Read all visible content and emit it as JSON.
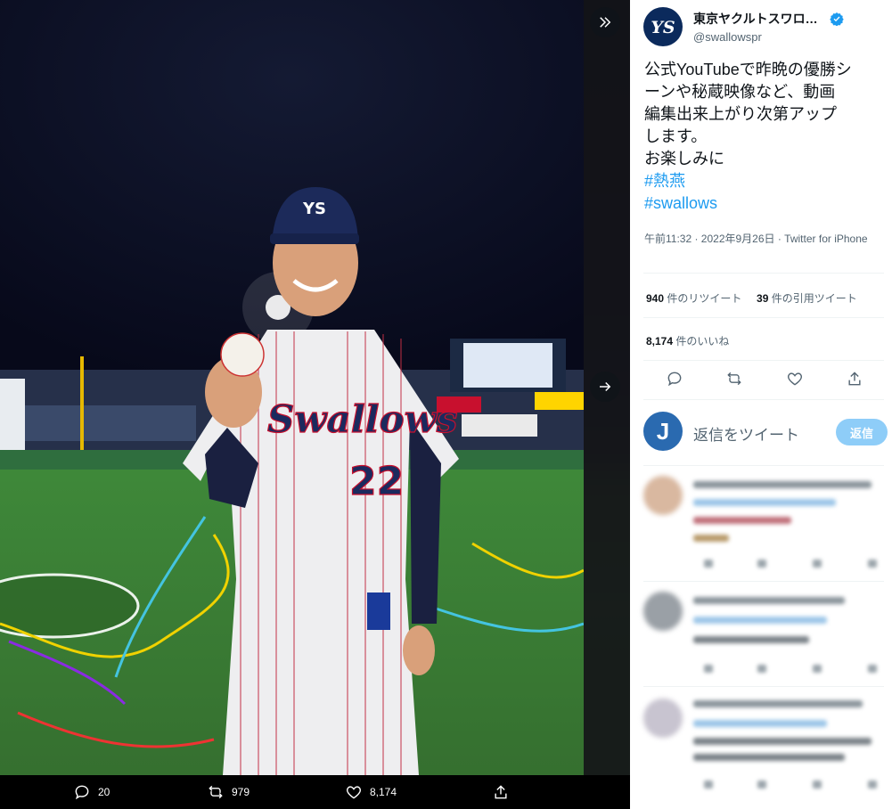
{
  "media": {
    "actions": {
      "reply_count": "20",
      "retweet_count": "979",
      "like_count": "8,174"
    }
  },
  "tweet": {
    "display_name": "東京ヤクルトスワロー...",
    "handle": "@swallowspr",
    "text_lines": [
      "公式YouTubeで昨晩の優勝シ",
      "ーンや秘蔵映像など、動画",
      "編集出来上がり次第アップ",
      "します。",
      "お楽しみに"
    ],
    "hashtags": [
      "#熱燕",
      "#swallows"
    ],
    "timestamp": "午前11:32 · 2022年9月26日 · Twitter for iPhone",
    "stats": {
      "retweets_num": "940",
      "retweets_label": " 件のリツイート",
      "quotes_num": "39",
      "quotes_label": " 件の引用ツイート",
      "likes_num": "8,174",
      "likes_label": " 件のいいね"
    }
  },
  "reply_box": {
    "avatar_letter": "J",
    "placeholder": "返信をツイート",
    "button_label": "返信"
  },
  "colors": {
    "accent": "#1d9bf0",
    "verified": "#1d9bf0",
    "team_navy": "#0b2a5c"
  }
}
